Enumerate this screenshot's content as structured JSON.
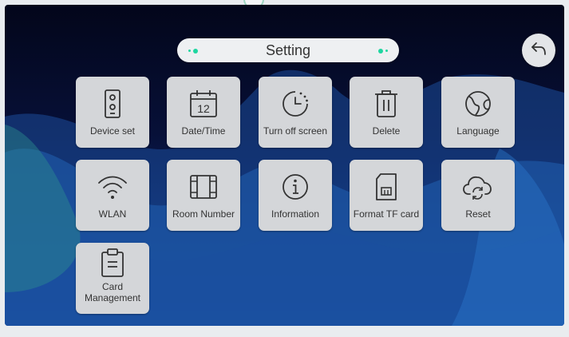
{
  "header": {
    "title": "Setting"
  },
  "nav": {
    "back_icon": "back-arrow-icon"
  },
  "tiles": [
    {
      "label": "Device set",
      "icon": "device-icon"
    },
    {
      "label": "Date/Time",
      "icon": "calendar-icon",
      "icon_text": "12"
    },
    {
      "label": "Turn off screen",
      "icon": "timer-icon"
    },
    {
      "label": "Delete",
      "icon": "trash-icon"
    },
    {
      "label": "Language",
      "icon": "globe-icon"
    },
    {
      "label": "WLAN",
      "icon": "wifi-icon"
    },
    {
      "label": "Room Number",
      "icon": "film-icon"
    },
    {
      "label": "Information",
      "icon": "info-icon"
    },
    {
      "label": "Format TF card",
      "icon": "sd-card-icon"
    },
    {
      "label": "Reset",
      "icon": "cloud-refresh-icon"
    },
    {
      "label": "Card Management",
      "icon": "clipboard-icon"
    }
  ],
  "colors": {
    "tile_bg": "#d4d6d9",
    "accent_dot": "#1ed6a0",
    "icon_stroke": "#333333"
  }
}
